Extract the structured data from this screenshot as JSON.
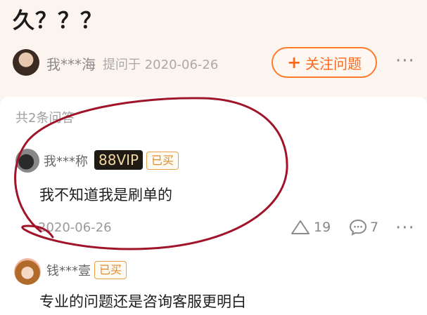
{
  "question": {
    "title_tail": "久？？？"
  },
  "asker": {
    "name": "我***海",
    "meta": "提问于 2020-06-26"
  },
  "follow_button": {
    "plus": "+",
    "label": "关注问题"
  },
  "more_label": "···",
  "answers_count": "共2条问答",
  "answers": [
    {
      "user": "我***称",
      "vip_badge": "88VIP",
      "bought_badge": "已买",
      "text": "我不知道我是刷单的",
      "date": "2020-06-26",
      "likes": "19",
      "comments": "7"
    },
    {
      "user": "钱***壹",
      "bought_badge": "已买",
      "text": "专业的问题还是咨询客服更明白"
    }
  ],
  "colors": {
    "accent": "#ff6a1a",
    "annotation": "#a0142a",
    "background": "#fcf4ef"
  }
}
